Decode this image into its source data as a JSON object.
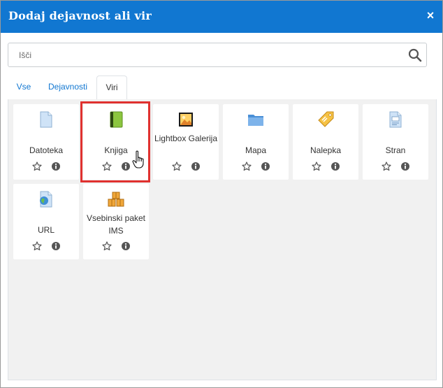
{
  "dialog": {
    "title": "Dodaj dejavnost ali vir",
    "close_glyph": "×"
  },
  "search": {
    "placeholder": "Išči"
  },
  "tabs": [
    {
      "label": "Vse",
      "active": false
    },
    {
      "label": "Dejavnosti",
      "active": false
    },
    {
      "label": "Viri",
      "active": true
    }
  ],
  "items": [
    {
      "name": "Datoteka",
      "icon": "file-icon"
    },
    {
      "name": "Knjiga",
      "icon": "book-icon"
    },
    {
      "name": "Lightbox Galerija",
      "icon": "lightbox-gallery-icon"
    },
    {
      "name": "Mapa",
      "icon": "folder-icon"
    },
    {
      "name": "Nalepka",
      "icon": "label-tag-icon"
    },
    {
      "name": "Stran",
      "icon": "page-icon"
    },
    {
      "name": "URL",
      "icon": "url-globe-icon"
    },
    {
      "name": "Vsebinski paket IMS",
      "icon": "ims-package-icon"
    }
  ],
  "colors": {
    "header": "#1177d1",
    "highlight": "#e0312f",
    "content_bg": "#f1f1f1"
  }
}
